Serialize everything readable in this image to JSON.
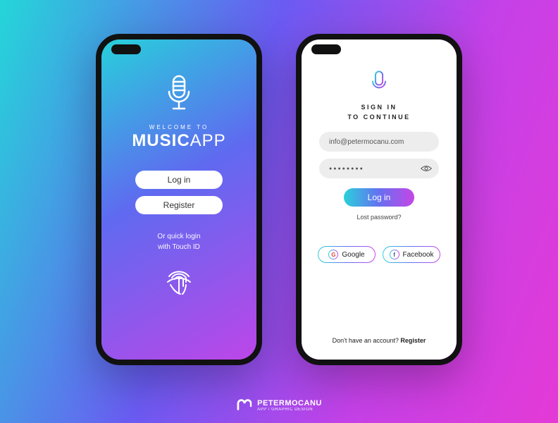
{
  "left": {
    "welcome": "WELCOME TO",
    "brand_bold": "MUSIC",
    "brand_thin": "APP",
    "login_label": "Log in",
    "register_label": "Register",
    "quick_login_line1": "Or quick login",
    "quick_login_line2": "with Touch ID"
  },
  "right": {
    "title_line1": "SIGN IN",
    "title_line2": "TO CONTINUE",
    "email_value": "info@petermocanu.com",
    "password_mask": "●●●●●●●●",
    "login_label": "Log in",
    "lost_password": "Lost password?",
    "google_label": "Google",
    "facebook_label": "Facebook",
    "register_prompt": "Don't have an account? ",
    "register_action": "Register"
  },
  "watermark": {
    "name": "PETERMOCANU",
    "sub": "APP / GRAPHIC DESIGN"
  }
}
